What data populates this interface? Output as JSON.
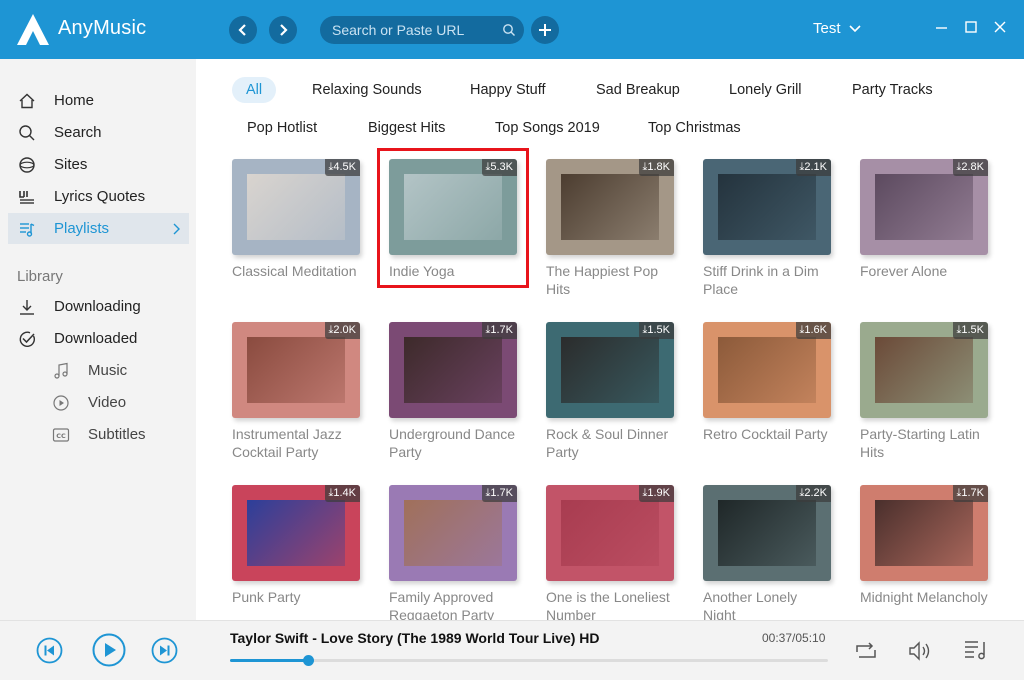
{
  "app": {
    "name": "AnyMusic",
    "user": "Test",
    "accent": "#1e95d4"
  },
  "search": {
    "placeholder": "Search or Paste URL"
  },
  "sidebar": {
    "items": [
      {
        "label": "Home",
        "icon": "home-icon"
      },
      {
        "label": "Search",
        "icon": "search-icon"
      },
      {
        "label": "Sites",
        "icon": "globe-icon"
      },
      {
        "label": "Lyrics Quotes",
        "icon": "quote-icon"
      },
      {
        "label": "Playlists",
        "icon": "playlist-icon",
        "active": true
      }
    ],
    "library_heading": "Library",
    "library": [
      {
        "label": "Downloading",
        "icon": "download-icon"
      },
      {
        "label": "Downloaded",
        "icon": "check-circle-icon"
      }
    ],
    "sub": [
      {
        "label": "Music",
        "icon": "music-note-icon"
      },
      {
        "label": "Video",
        "icon": "play-circle-icon"
      },
      {
        "label": "Subtitles",
        "icon": "cc-icon"
      }
    ]
  },
  "categories": {
    "row1": [
      "All",
      "Relaxing Sounds",
      "Happy Stuff",
      "Sad Breakup",
      "Lonely Grill",
      "Party Tracks"
    ],
    "row2": [
      "Pop Hotlist",
      "Biggest Hits",
      "Top Songs 2019",
      "Top Christmas"
    ],
    "active": "All"
  },
  "playlists": [
    {
      "title": "Classical Meditation",
      "downloads": "4.5K",
      "frame": "#a6b4c4",
      "inner": "#d9d4cf"
    },
    {
      "title": "Indie Yoga",
      "downloads": "5.3K",
      "frame": "#7d9c9b",
      "inner": "#b3c4c6",
      "highlighted": true
    },
    {
      "title": "The Happiest Pop Hits",
      "downloads": "1.8K",
      "frame": "#a49787",
      "inner": "#4c3d30"
    },
    {
      "title": "Stiff Drink in a Dim Place",
      "downloads": "2.1K",
      "frame": "#4a6675",
      "inner": "#24333d"
    },
    {
      "title": "Forever Alone",
      "downloads": "2.8K",
      "frame": "#a68fa6",
      "inner": "#5c4a5f"
    },
    {
      "title": "Instrumental Jazz Cocktail Party",
      "downloads": "2.0K",
      "frame": "#d08880",
      "inner": "#8a4b3f"
    },
    {
      "title": "Underground Dance Party",
      "downloads": "1.7K",
      "frame": "#7b4a74",
      "inner": "#3d2a2a"
    },
    {
      "title": "Rock & Soul Dinner Party",
      "downloads": "1.5K",
      "frame": "#3d6a72",
      "inner": "#2b2c2c"
    },
    {
      "title": "Retro Cocktail Party",
      "downloads": "1.6K",
      "frame": "#d9936a",
      "inner": "#8c5a3a"
    },
    {
      "title": "Party-Starting Latin Hits",
      "downloads": "1.5K",
      "frame": "#9aaa8e",
      "inner": "#6b4a38"
    },
    {
      "title": "Punk Party",
      "downloads": "1.4K",
      "frame": "#c9445b",
      "inner": "#2c3f9a"
    },
    {
      "title": "Family Approved Reggaeton Party",
      "downloads": "1.7K",
      "frame": "#9a7ab4",
      "inner": "#a0705a"
    },
    {
      "title": "One is the Loneliest Number",
      "downloads": "1.9K",
      "frame": "#c25468",
      "inner": "#a83c50"
    },
    {
      "title": "Another Lonely Night",
      "downloads": "2.2K",
      "frame": "#5b6f72",
      "inner": "#1f2728"
    },
    {
      "title": "Midnight Melancholy",
      "downloads": "1.7K",
      "frame": "#cf7d6e",
      "inner": "#4a2f2c"
    }
  ],
  "player": {
    "track": "Taylor Swift - Love Story (The 1989 World Tour Live) HD",
    "time": "00:37/05:10",
    "progress_fraction": 0.13
  }
}
